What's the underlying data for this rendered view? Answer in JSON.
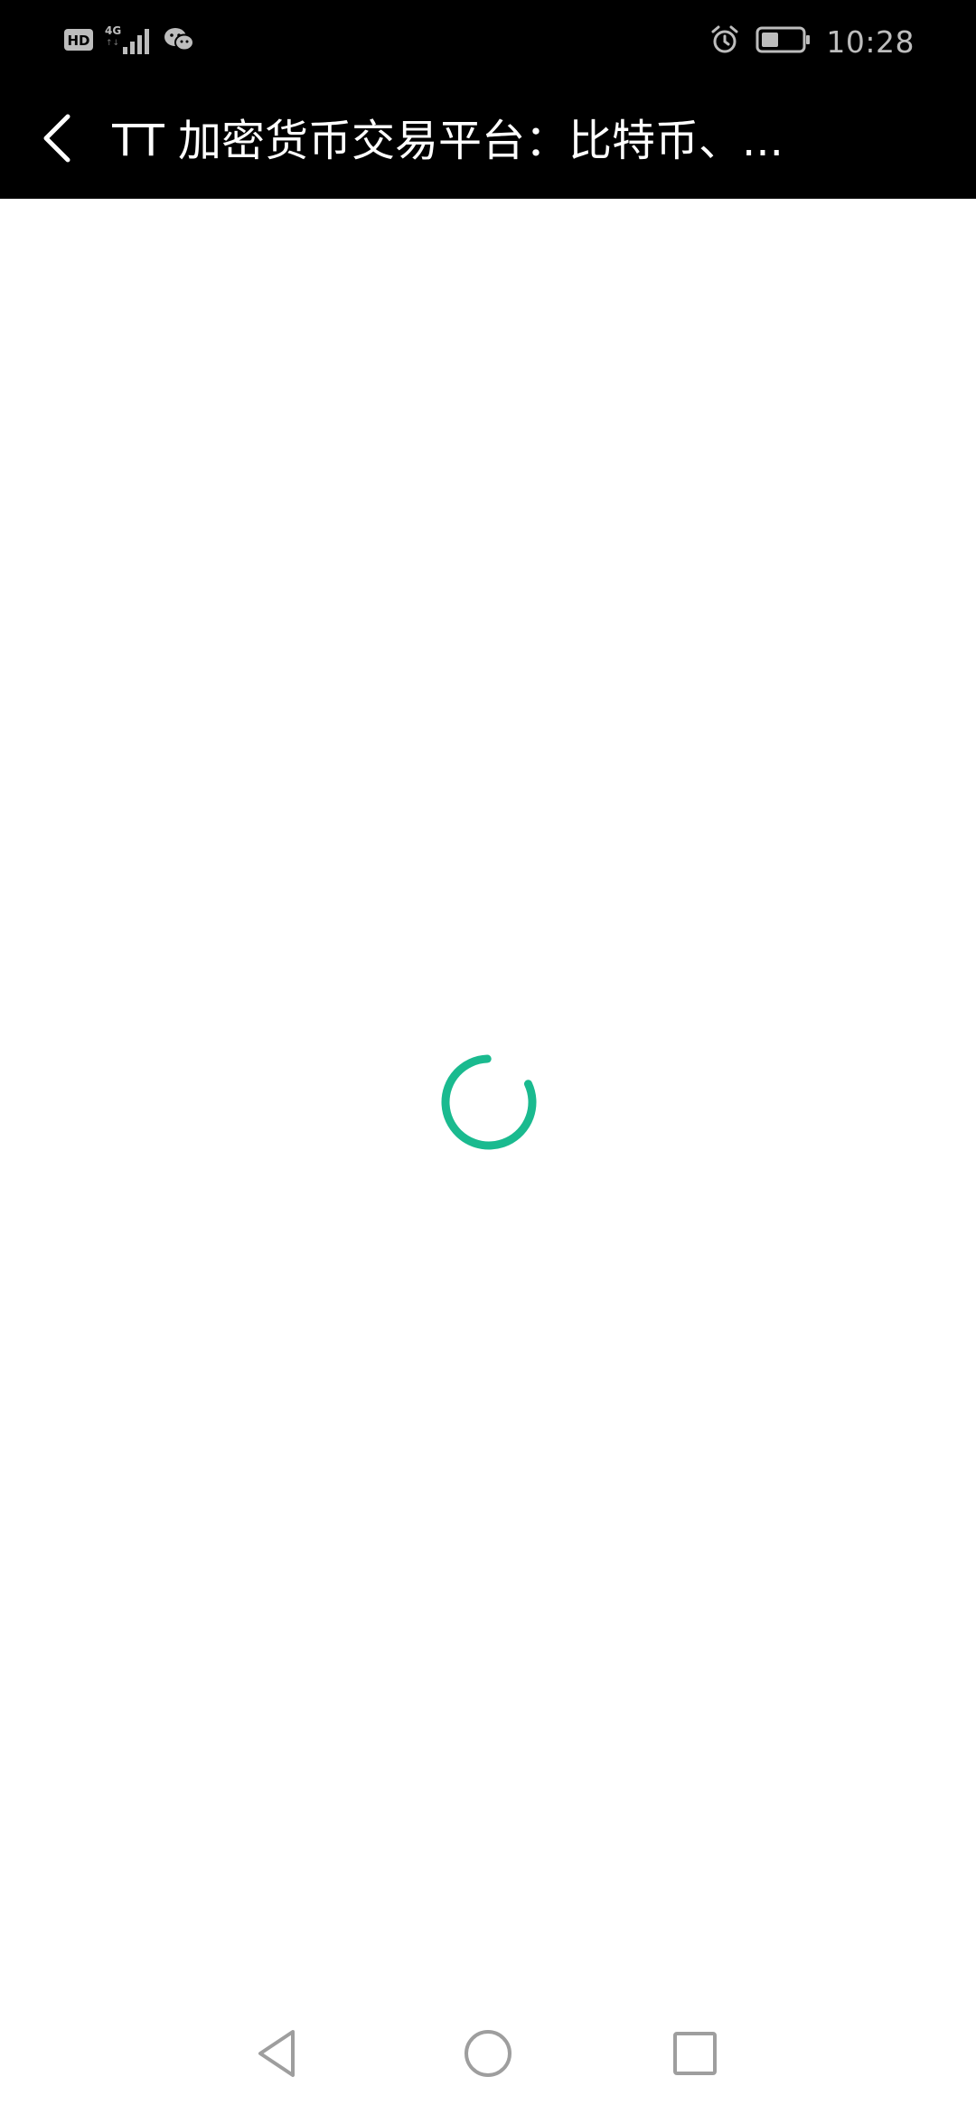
{
  "status_bar": {
    "hd_label": "HD",
    "network_label": "4G",
    "time": "10:28",
    "icons": [
      "hd-icon",
      "signal-icon",
      "wechat-icon",
      "alarm-icon",
      "battery-icon"
    ]
  },
  "app_bar": {
    "title": "TT 加密货币交易平台：比特币、...",
    "back_icon": "chevron-left-icon"
  },
  "content": {
    "spinner_color": "#1aba8f"
  },
  "nav_bar": {
    "icons": [
      "back-triangle-icon",
      "home-circle-icon",
      "recents-square-icon"
    ]
  }
}
